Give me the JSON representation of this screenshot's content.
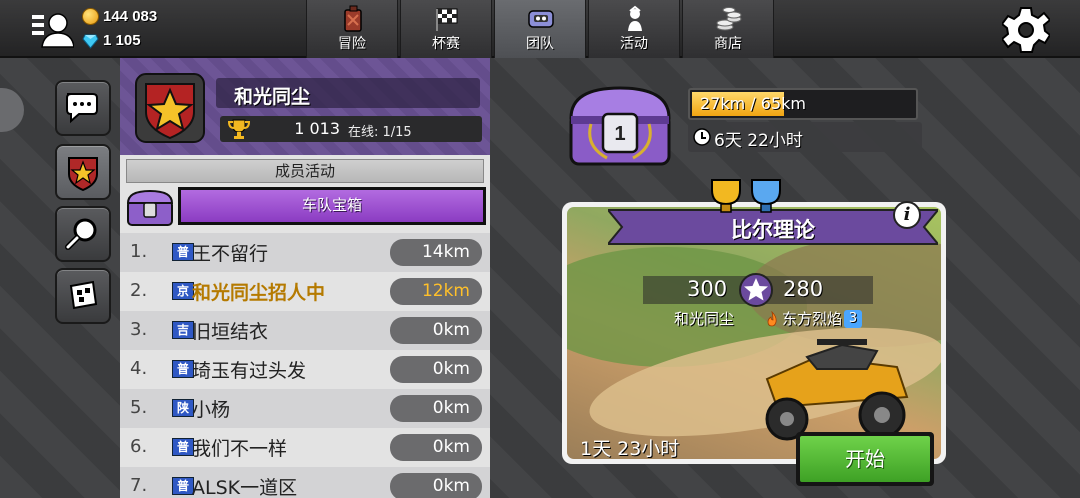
{
  "currency": {
    "coins": "144 083",
    "gems": "1 105"
  },
  "tabs": [
    {
      "label": "冒险",
      "icon": "fuel-can-icon"
    },
    {
      "label": "杯赛",
      "icon": "checkered-flag-icon"
    },
    {
      "label": "团队",
      "icon": "team-car-icon"
    },
    {
      "label": "活动",
      "icon": "event-icon"
    },
    {
      "label": "商店",
      "icon": "shop-coins-icon"
    }
  ],
  "active_tab": "团队",
  "team": {
    "name": "和光同尘",
    "score": "1 013",
    "online": "在线: 1/15"
  },
  "activity": {
    "section_title": "成员活动",
    "chest_button_label": "车队宝箱"
  },
  "members": [
    {
      "rank": "1.",
      "flag": "普",
      "name": "王不留行",
      "distance": "14km"
    },
    {
      "rank": "2.",
      "flag": "京",
      "name": "和光同尘招人中",
      "distance": "12km"
    },
    {
      "rank": "3.",
      "flag": "吉",
      "name": "旧垣结衣",
      "distance": "0km"
    },
    {
      "rank": "4.",
      "flag": "普",
      "name": "琦玉有过头发",
      "distance": "0km"
    },
    {
      "rank": "5.",
      "flag": "陕",
      "name": "小杨",
      "distance": "0km"
    },
    {
      "rank": "6.",
      "flag": "普",
      "name": "我们不一样",
      "distance": "0km"
    },
    {
      "rank": "7.",
      "flag": "普",
      "name": "ALSK一道区",
      "distance": "0km"
    }
  ],
  "chest": {
    "level": "1",
    "progress_text": "27km / 65km",
    "progress_fraction": 0.415,
    "timer": "6天 22小时"
  },
  "event": {
    "title": "比尔理论",
    "score_left": "300",
    "score_right": "280",
    "team_left": "和光同尘",
    "team_right": "东方烈焰",
    "team_right_level": "3",
    "time_left": "1天 23小时",
    "start_label": "开始",
    "info_label": "i"
  },
  "colors": {
    "progress": "#f1a512",
    "start_green": "#3ea125",
    "team_purple": "#6d5596",
    "chest_purple": "#8b3cc2"
  }
}
